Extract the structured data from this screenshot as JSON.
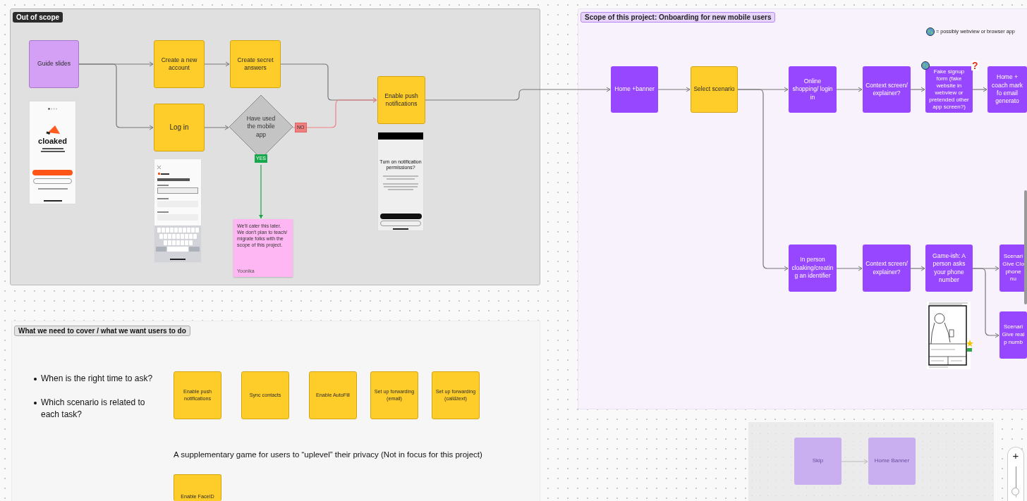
{
  "out_of_scope": {
    "label": "Out of scope",
    "nodes": [
      {
        "kind": "slide",
        "text": "Guide slides"
      },
      {
        "kind": "task",
        "text": "Create a new account"
      },
      {
        "kind": "task",
        "text": "Create secret answers"
      },
      {
        "kind": "task",
        "text": "Log in"
      },
      {
        "kind": "task",
        "text": "Enable push notifications"
      }
    ],
    "decision": {
      "text": "Have used the mobile app",
      "no_label": "NO",
      "yes_label": "YES"
    },
    "mockups": [
      {
        "kind": "welcome",
        "logo": "cloaked"
      },
      {
        "kind": "signup"
      },
      {
        "kind": "permission",
        "title": "Turn on notification permissions?"
      }
    ],
    "sticky_note": {
      "text": "We'll cater this later. We don't plan to teach/ migrate folks with the scope of this project.",
      "author": "Yoonika"
    }
  },
  "scope": {
    "label": "Scope of this project: Onboarding for new mobile users",
    "legend": "= possibly webview or browser app",
    "flow_rows": [
      {
        "nodes": [
          {
            "kind": "screen",
            "text": "Home +banner",
            "webview": false
          },
          {
            "kind": "task",
            "text": "Select scenario",
            "webview": false
          },
          {
            "kind": "screen",
            "text": "Online shopping/ login in",
            "webview": false
          },
          {
            "kind": "screen",
            "text": "Context screen/ explainer?",
            "webview": false
          },
          {
            "kind": "screen",
            "text": "Fake signup form (fake website in webview or pretended other app screen?)",
            "webview": true,
            "question_mark": "?"
          },
          {
            "kind": "screen",
            "text": "Home + coach mark fo email generato",
            "webview": false
          }
        ]
      },
      {
        "nodes": [
          {
            "kind": "screen",
            "text": "In person cloaking/creating an identifier",
            "webview": false
          },
          {
            "kind": "screen",
            "text": "Context screen/ explainer?",
            "webview": false
          },
          {
            "kind": "screen",
            "text": "Game-ish: A person asks your phone number",
            "webview": false
          },
          {
            "kind": "screen",
            "text": "Scenari Give Clo phone nu",
            "webview": false
          }
        ]
      },
      {
        "nodes": [
          {
            "kind": "screen",
            "text": "Scenari Give real p numb",
            "webview": false
          }
        ]
      }
    ]
  },
  "coverage": {
    "label": "What we need to cover / what we want users to do",
    "questions": [
      "When is the right time to ask?",
      "Which scenario is related to each task?"
    ],
    "tasks": [
      {
        "kind": "task",
        "text": "Enable push notifications"
      },
      {
        "kind": "task",
        "text": "Sync contacts"
      },
      {
        "kind": "task",
        "text": "Enable AutoFill"
      },
      {
        "kind": "task",
        "text": "Set up forwarding (email)"
      },
      {
        "kind": "task",
        "text": "Set up forwarding (call&text)"
      }
    ],
    "supplement_text": "A supplementary game for users to “uplevel” their privacy (Not in focus for this project)",
    "supplement_tasks": [
      {
        "kind": "task",
        "text": "Enable FaceID"
      }
    ]
  },
  "skip_flow": {
    "nodes": [
      {
        "kind": "ghost",
        "text": "Skip"
      },
      {
        "kind": "ghost",
        "text": "Home Banner"
      }
    ]
  },
  "zoom_control": {
    "zoom_in": "+",
    "level": 0.8
  }
}
